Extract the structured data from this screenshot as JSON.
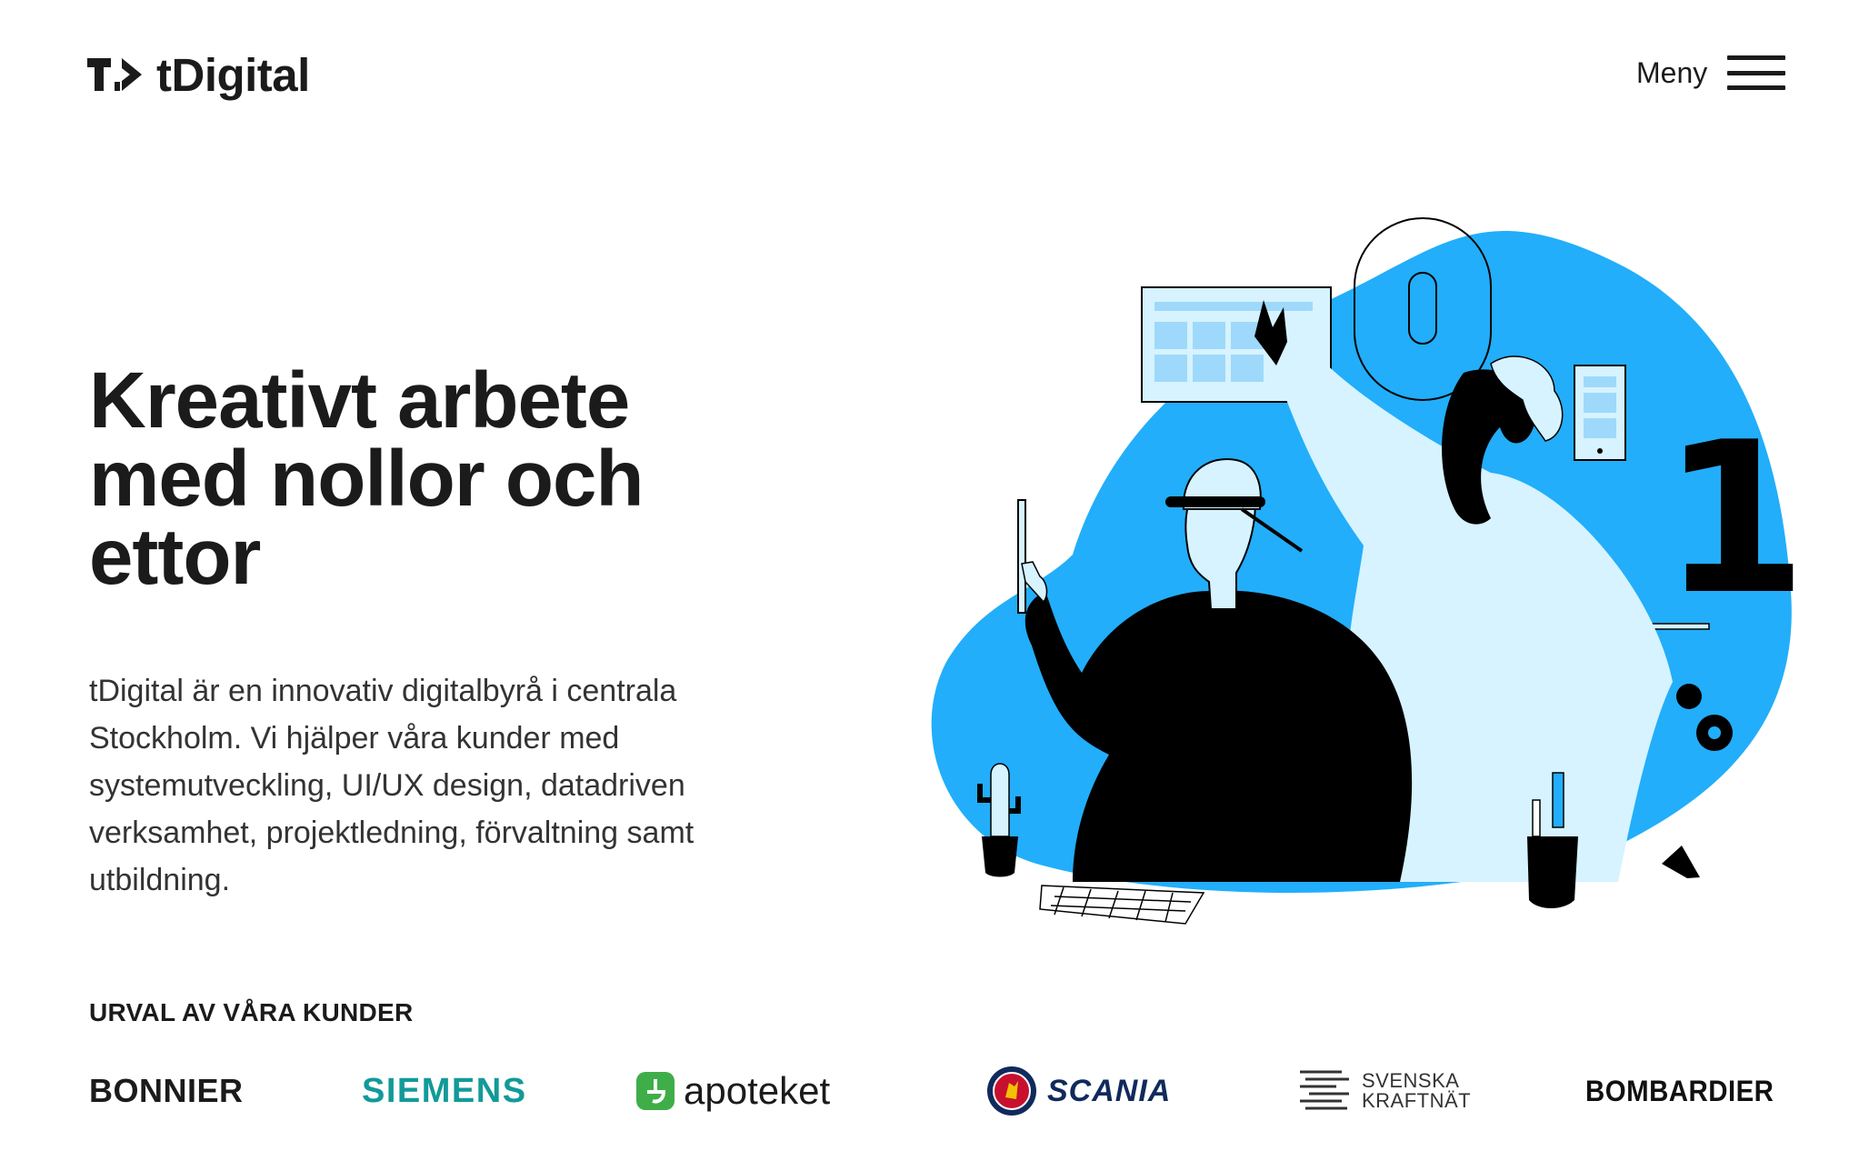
{
  "header": {
    "brand": "tDigital",
    "menu_label": "Meny"
  },
  "hero": {
    "title_lines": [
      "Kreativt arbete",
      "med nollor och",
      "ettor"
    ],
    "description": "tDigital är en innovativ digitalbyrå i centrala Stockholm. Vi hjälper våra kunder med systemutveckling, UI/UX design, datadriven verksamhet, projektledning, förvaltning samt utbildning."
  },
  "clients": {
    "heading": "URVAL AV VÅRA KUNDER",
    "items": [
      {
        "name": "BONNIER",
        "icon": null
      },
      {
        "name": "SIEMENS",
        "icon": null
      },
      {
        "name": "apoteket",
        "icon": "apoteket-cross-icon"
      },
      {
        "name": "SCANIA",
        "icon": "scania-griffin-icon"
      },
      {
        "name_lines": [
          "SVENSKA",
          "KRAFTNÄT"
        ],
        "icon": "svk-wave-icon"
      },
      {
        "name": "BOMBARDIER",
        "icon": null
      }
    ]
  },
  "illustration": {
    "digit": "1",
    "colors": {
      "blob": "#22aefa",
      "light": "#d6f3ff",
      "ink": "#000000"
    }
  },
  "colors": {
    "text": "#1b1b1b",
    "siemens": "#129a9a",
    "apoteket": "#3fae49",
    "scania": "#0f2a5c"
  }
}
